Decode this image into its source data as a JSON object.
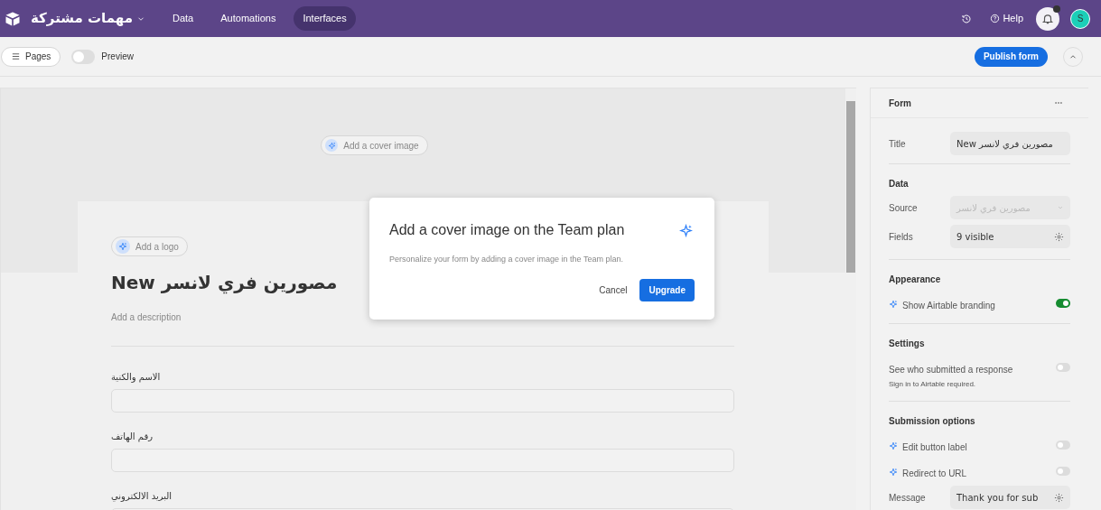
{
  "top_bar": {
    "workspace": "مهمات مشتركة",
    "nav": [
      {
        "label": "Data",
        "selected": false
      },
      {
        "label": "Automations",
        "selected": false
      },
      {
        "label": "Interfaces",
        "selected": true
      }
    ],
    "help": "Help",
    "avatar": "S"
  },
  "toolbar": {
    "pages": "Pages",
    "preview": {
      "label": "Preview",
      "on": false
    },
    "publish": "Publish form"
  },
  "canvas": {
    "cover_button": "Add a cover image",
    "logo_button": "Add a logo",
    "title": "New مصورين فري لانسر",
    "description_placeholder": "Add a description",
    "fields": [
      {
        "label": "الاسم والكنية"
      },
      {
        "label": "رقم الهاتف"
      },
      {
        "label": "البريد الالكتروني"
      }
    ]
  },
  "dialog": {
    "title": "Add a cover image on the Team plan",
    "body": "Personalize your form by adding a cover image in the Team plan.",
    "cancel": "Cancel",
    "confirm": "Upgrade"
  },
  "panel": {
    "header": "Form",
    "title_row": {
      "label": "Title",
      "value": "New مصورين فري لانسر"
    },
    "sections": [
      {
        "heading": "Data",
        "rows": [
          {
            "kind": "select",
            "label": "Source",
            "value": "مصورين فري لانسر",
            "disabled": true
          },
          {
            "kind": "settings",
            "label": "Fields",
            "value": "9 visible"
          }
        ]
      },
      {
        "heading": "Appearance",
        "rows": [
          {
            "kind": "toggle",
            "label": "Show Airtable branding",
            "on": true,
            "premium": true
          }
        ]
      },
      {
        "heading": "Settings",
        "rows": [
          {
            "kind": "toggle",
            "label": "See who submitted a response",
            "note": "Sign in to Airtable required.",
            "on": false,
            "premium": false
          }
        ]
      },
      {
        "heading": "Submission options",
        "rows": [
          {
            "kind": "toggle",
            "label": "Edit button label",
            "on": false,
            "premium": true
          },
          {
            "kind": "toggle",
            "label": "Redirect to URL",
            "on": false,
            "premium": true
          },
          {
            "kind": "settings",
            "label": "Message",
            "value": "Thank you for sub"
          }
        ]
      }
    ]
  }
}
